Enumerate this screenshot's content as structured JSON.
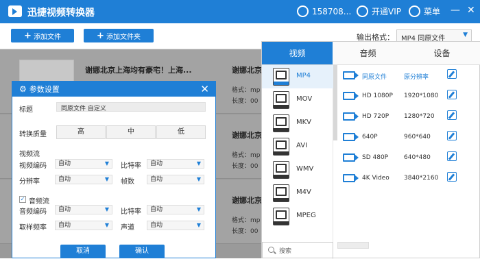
{
  "app": {
    "title": "迅捷视频转换器",
    "user": "158708...",
    "vip": "开通VIP",
    "menu": "菜单",
    "minimize": "—",
    "close": "✕"
  },
  "toolbar": {
    "add_file": "添加文件",
    "add_folder": "添加文件夹",
    "format_label": "输出格式：",
    "format_value": "MP4 同原文件"
  },
  "list": {
    "rows": [
      {
        "title_left": "谢娜北京上海均有豪宅！上海...",
        "title_right": "谢娜北京",
        "format": "格式：mp",
        "duration": "长度：00"
      },
      {
        "title_right": "谢娜北京",
        "format": "格式：mp",
        "duration": "长度：00"
      },
      {
        "title_right": "谢娜北京",
        "format": "格式：mp",
        "duration": "长度：00"
      }
    ]
  },
  "params": {
    "title": "参数设置",
    "title_label": "标题",
    "title_value": "同原文件 自定义",
    "quality_label": "转换质量",
    "quality": [
      "高",
      "中",
      "低"
    ],
    "video_section": "视频流",
    "video_codec_label": "视频编码",
    "video_codec": "自动",
    "bitrate_label": "比特率",
    "bitrate": "自动",
    "resolution_label": "分辨率",
    "resolution": "自动",
    "fps_label": "帧数",
    "fps": "自动",
    "audio_section": "音频流",
    "audio_codec_label": "音频编码",
    "audio_codec": "自动",
    "audio_bitrate_label": "比特率",
    "audio_bitrate": "自动",
    "sample_label": "取样频率",
    "sample": "自动",
    "channel_label": "声道",
    "channel": "自动",
    "cancel": "取消",
    "ok": "确认"
  },
  "format_panel": {
    "tabs": [
      "视频",
      "音频",
      "设备"
    ],
    "formats": [
      "MP4",
      "MOV",
      "MKV",
      "AVI",
      "WMV",
      "M4V",
      "MPEG"
    ],
    "format_icon_labels": [
      "MP4",
      "MOV",
      "MKV",
      "AVI",
      "WMV",
      "M4V",
      "MPEG"
    ],
    "presets": [
      {
        "name": "同原文件",
        "value": "原分辨率"
      },
      {
        "name": "HD 1080P",
        "value": "1920*1080"
      },
      {
        "name": "HD 720P",
        "value": "1280*720"
      },
      {
        "name": "640P",
        "value": "960*640"
      },
      {
        "name": "SD 480P",
        "value": "640*480"
      },
      {
        "name": "4K Video",
        "value": "3840*2160"
      }
    ],
    "search_placeholder": "搜索"
  },
  "colors": {
    "accent": "#1f7fd6",
    "overlay": "#9a9a9a"
  }
}
